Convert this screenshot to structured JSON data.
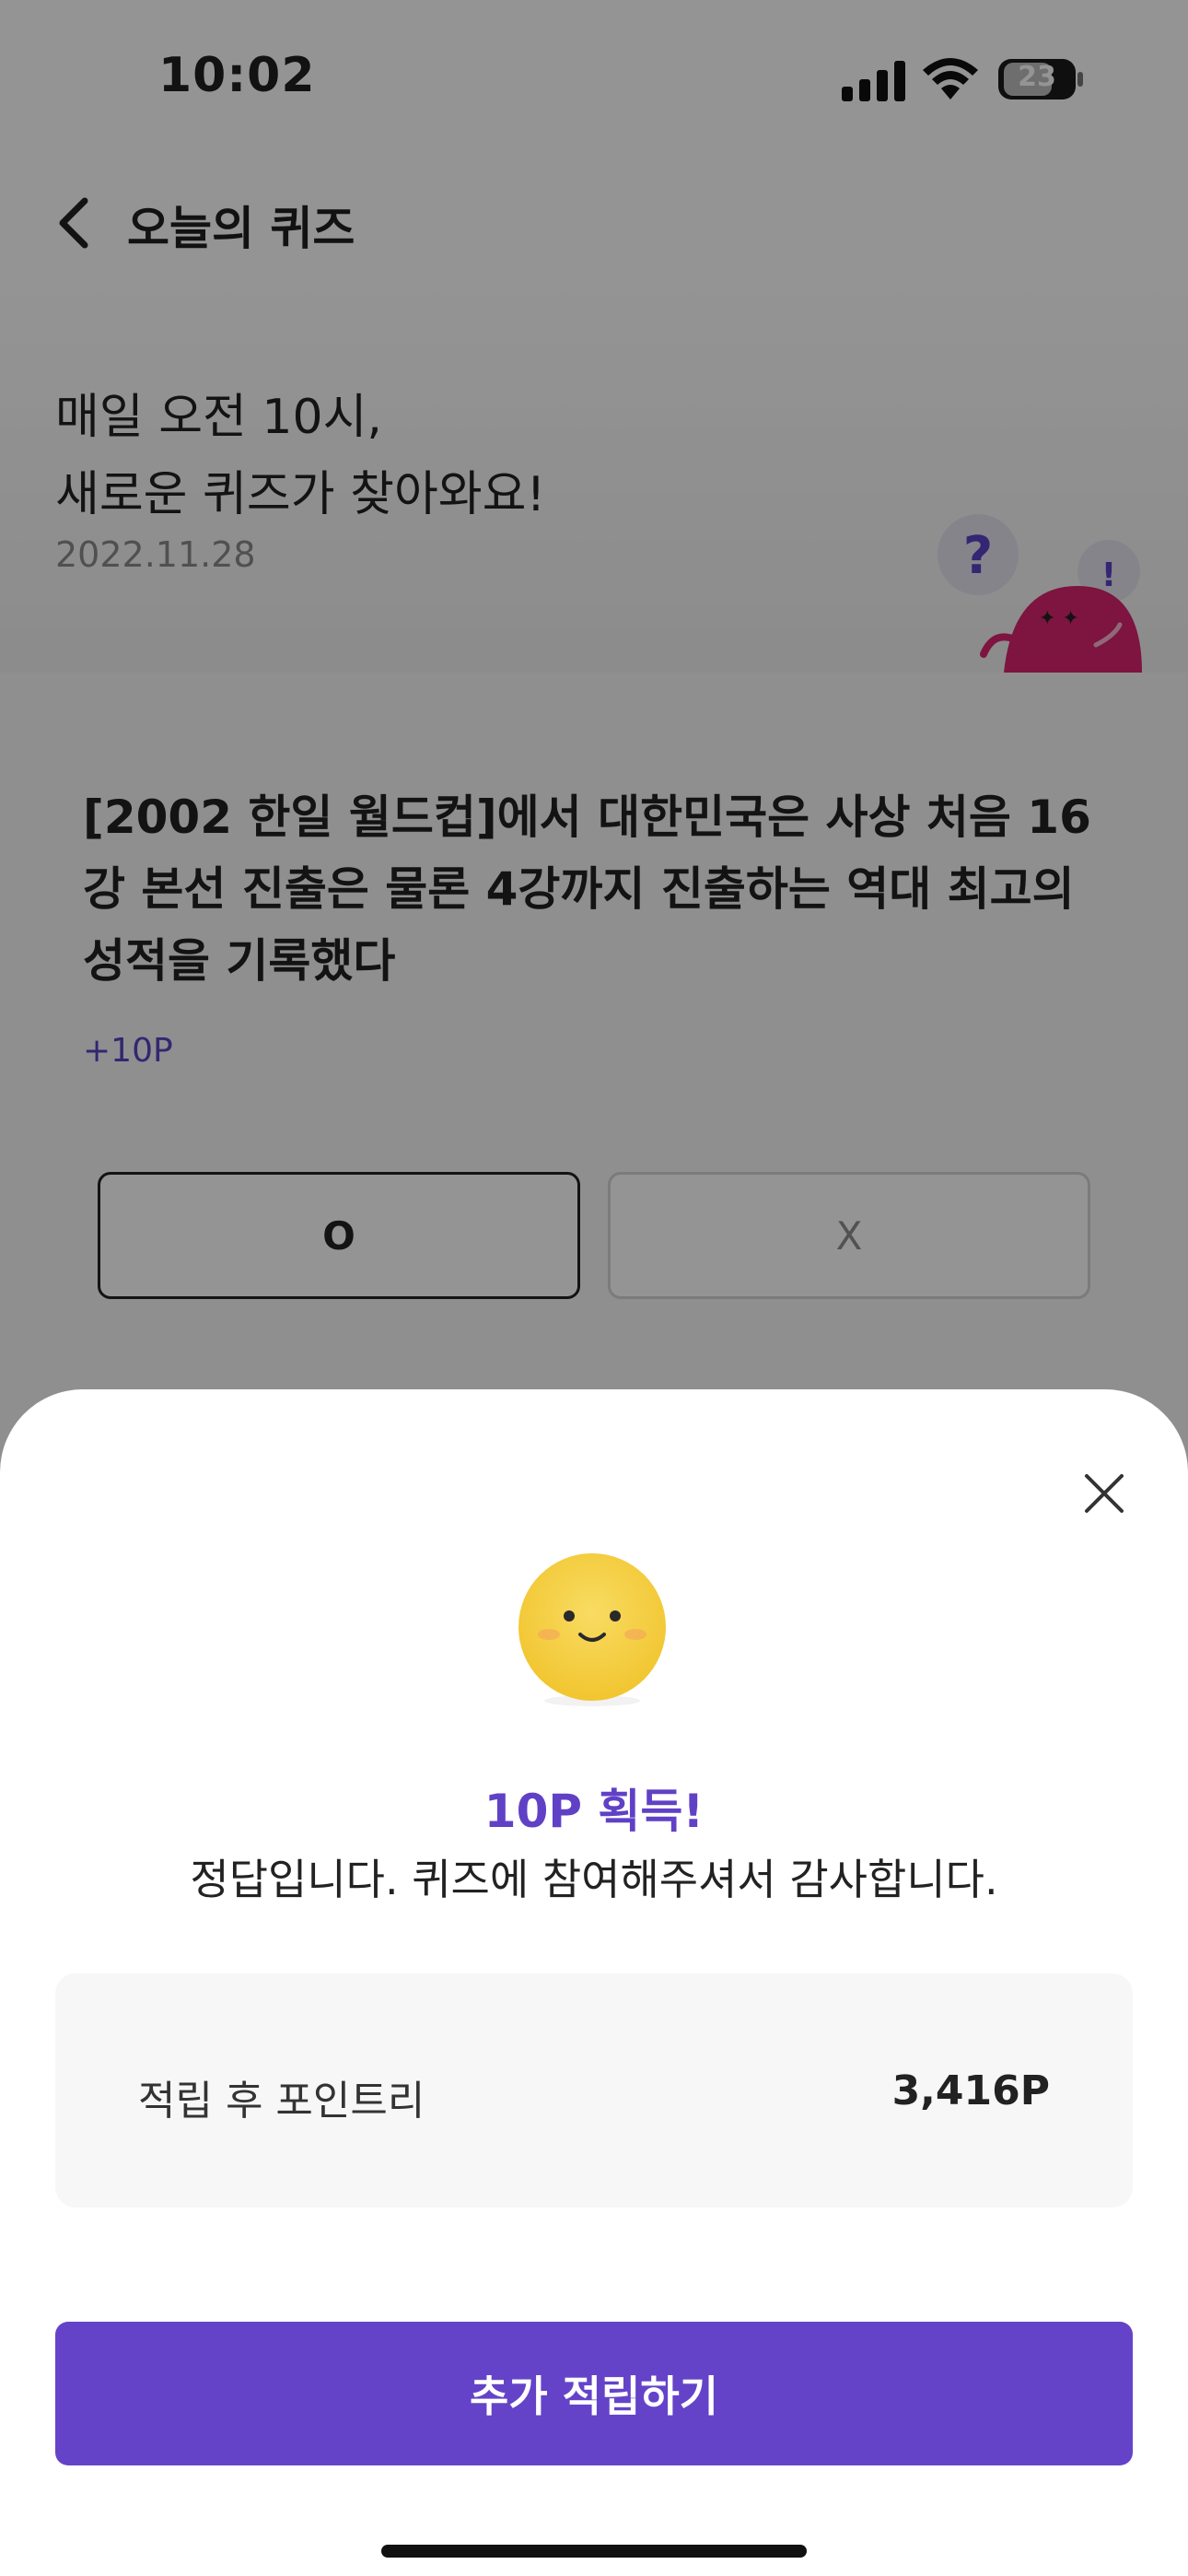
{
  "status_bar": {
    "time": "10:02",
    "battery": "23"
  },
  "nav": {
    "title": "오늘의 퀴즈"
  },
  "hero": {
    "line1": "매일 오전 10시,",
    "line2": "새로운 퀴즈가 찾아와요!",
    "date": "2022.11.28",
    "mascot_icon": "quiz-mascot-icon"
  },
  "quiz": {
    "question": "[2002 한일 월드컵]에서 대한민국은 사상 처음 16강 본선 진출은 물론 4강까지 진출하는 역대 최고의 성적을 기록했다",
    "reward": "+10P",
    "option_o": "O",
    "option_x": "X"
  },
  "result_sheet": {
    "title": "10P 획득!",
    "message": "정답입니다. 퀴즈에 참여해주셔서 감사합니다.",
    "points_label": "적립 후 포인트리",
    "points_value": "3,416P",
    "cta_label": "추가 적립하기"
  },
  "colors": {
    "accent": "#6443c8",
    "mascot": "#d9246e",
    "emoji": "#f5cd3a"
  }
}
